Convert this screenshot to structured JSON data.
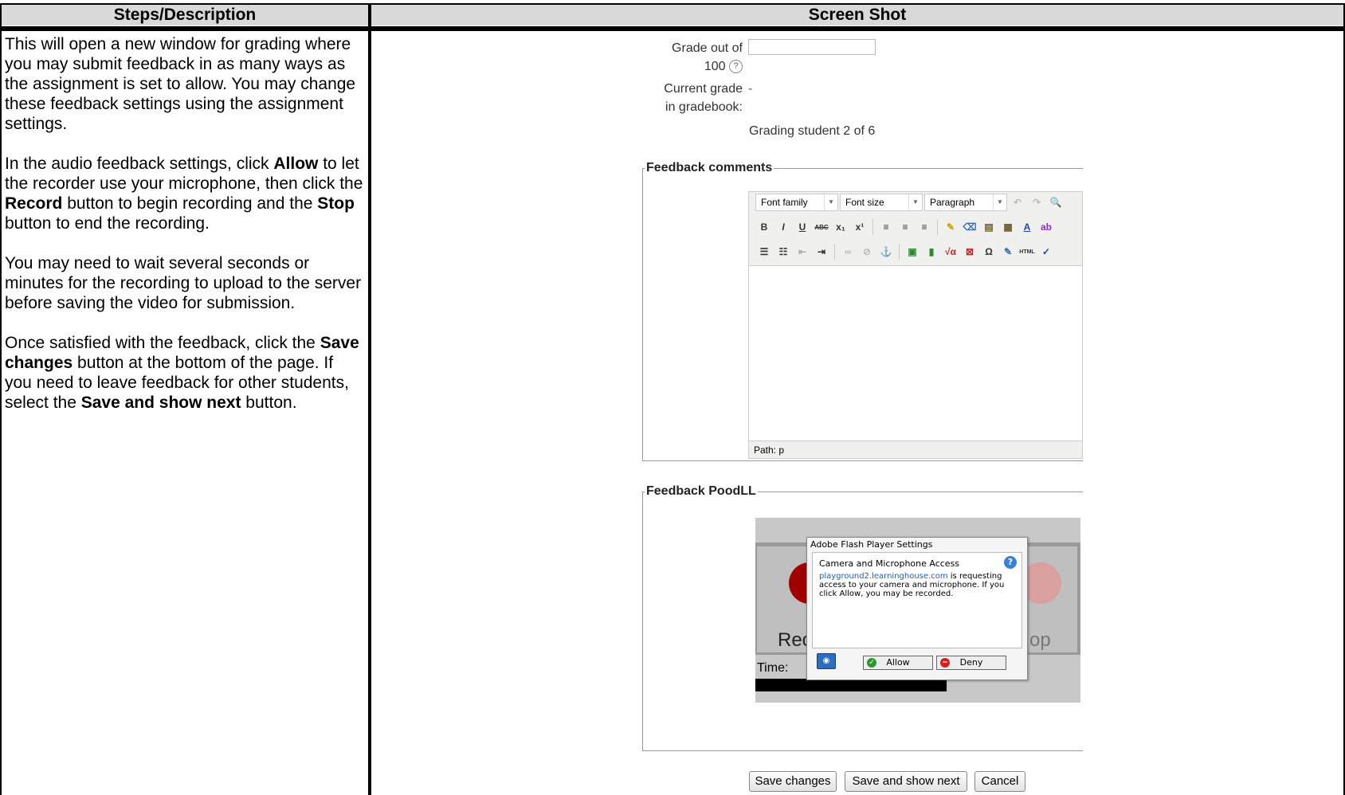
{
  "table": {
    "header_left": "Steps/Description",
    "header_right": "Screen Shot"
  },
  "description": {
    "p1": "This will open a new window for grading where you may submit feedback in as many ways as the assignment is set to allow. You may change these feedback settings using the assignment settings.",
    "p2_a": "In the audio feedback settings, click ",
    "p2_b": "Allow",
    "p2_c": " to let the recorder use your microphone, then click the ",
    "p2_d": "Record",
    "p2_e": " button to begin recording and the ",
    "p2_f": "Stop",
    "p2_g": " button to end the recording.",
    "p3": "You may need to wait several seconds or minutes for the recording to upload to the server before saving the video for submission.",
    "p4_a": "Once satisfied with the feedback, click the ",
    "p4_b": "Save changes",
    "p4_c": " button at the bottom of the page. If you need to leave feedback for other students, select the ",
    "p4_d": "Save and show next",
    "p4_e": " button."
  },
  "form": {
    "grade_label": "Grade out of",
    "grade_max": "100",
    "grade_value": "",
    "current_grade_label_1": "Current grade",
    "current_grade_label_2": "in gradebook:",
    "current_grade_value": "-",
    "grading_status": "Grading student 2 of 6"
  },
  "feedback_comments": {
    "legend": "Feedback comments",
    "font_family": "Font family",
    "font_size": "Font size",
    "paragraph": "Paragraph",
    "path": "Path: p"
  },
  "feedback_poodll": {
    "legend": "Feedback PoodLL",
    "record_label": "Rec",
    "stop_label": "op",
    "time_label": "Time:"
  },
  "flash_dialog": {
    "title": "Adobe Flash Player Settings",
    "heading": "Camera and Microphone Access",
    "host": "playground2.learninghouse.com",
    "message": " is requesting access to your camera and microphone. If you click Allow, you may be recorded.",
    "allow": "Allow",
    "deny": "Deny",
    "help_icon": "?"
  },
  "buttons": {
    "save": "Save changes",
    "save_next": "Save and show next",
    "cancel": "Cancel"
  }
}
